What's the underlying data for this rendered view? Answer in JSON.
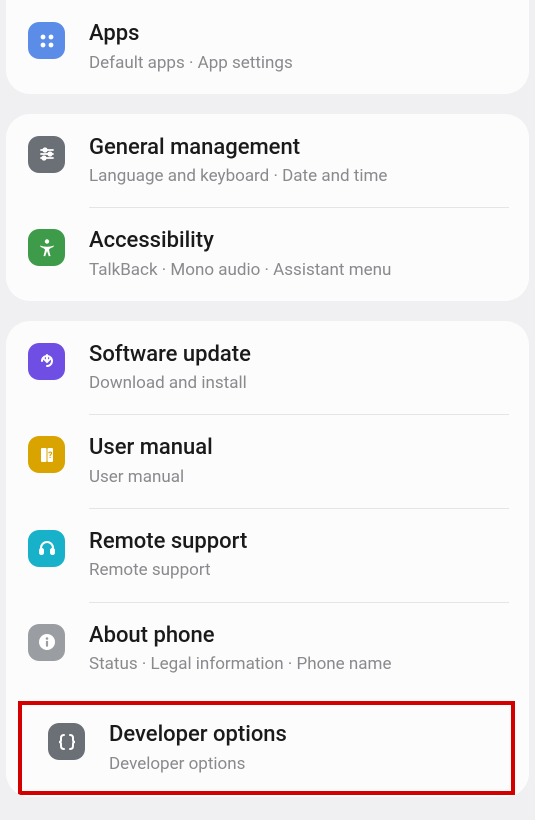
{
  "groups": [
    {
      "items": [
        {
          "id": "apps",
          "icon": "apps-icon",
          "iconClass": "ic-blue",
          "title": "Apps",
          "subtitle": "Default apps  ·  App settings"
        }
      ]
    },
    {
      "items": [
        {
          "id": "general-management",
          "icon": "sliders-icon",
          "iconClass": "ic-gray",
          "title": "General management",
          "subtitle": "Language and keyboard  ·  Date and time"
        },
        {
          "id": "accessibility",
          "icon": "accessibility-icon",
          "iconClass": "ic-green",
          "title": "Accessibility",
          "subtitle": "TalkBack  ·  Mono audio  ·  Assistant menu"
        }
      ]
    },
    {
      "items": [
        {
          "id": "software-update",
          "icon": "update-icon",
          "iconClass": "ic-purple",
          "title": "Software update",
          "subtitle": "Download and install"
        },
        {
          "id": "user-manual",
          "icon": "manual-icon",
          "iconClass": "ic-yellow",
          "title": "User manual",
          "subtitle": "User manual"
        },
        {
          "id": "remote-support",
          "icon": "headset-icon",
          "iconClass": "ic-teal",
          "title": "Remote support",
          "subtitle": "Remote support"
        },
        {
          "id": "about-phone",
          "icon": "info-icon",
          "iconClass": "ic-midgray",
          "title": "About phone",
          "subtitle": "Status  ·  Legal information  ·  Phone name"
        },
        {
          "id": "developer-options",
          "icon": "braces-icon",
          "iconClass": "ic-dkgray",
          "title": "Developer options",
          "subtitle": "Developer options",
          "highlight": true
        }
      ]
    }
  ]
}
